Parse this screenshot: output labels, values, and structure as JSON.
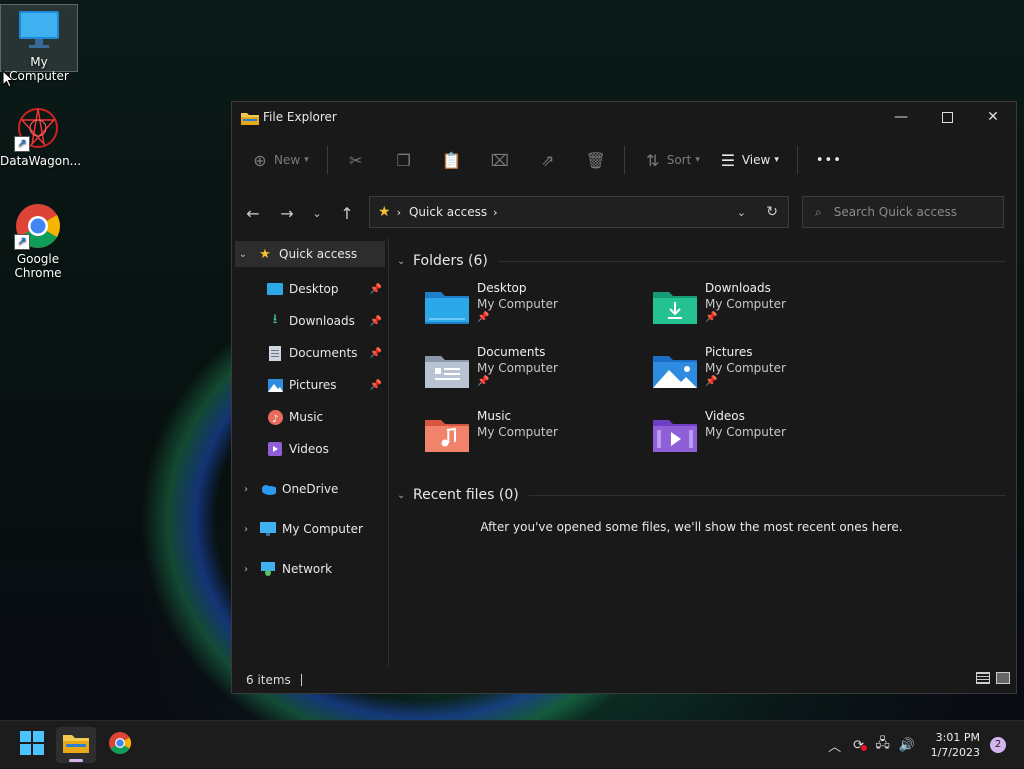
{
  "desktop": {
    "icons": [
      {
        "label": "My Computer"
      },
      {
        "label": "DataWagon..."
      },
      {
        "label": "Google Chrome"
      }
    ]
  },
  "window": {
    "title": "File Explorer",
    "toolbar": {
      "new_label": "New",
      "sort_label": "Sort",
      "view_label": "View",
      "more_label": "•••"
    },
    "address": {
      "location": "Quick access",
      "search_placeholder": "Search Quick access"
    },
    "nav": {
      "quick_access": "Quick access",
      "pinned": [
        {
          "label": "Desktop",
          "pinned": true
        },
        {
          "label": "Downloads",
          "pinned": true
        },
        {
          "label": "Documents",
          "pinned": true
        },
        {
          "label": "Pictures",
          "pinned": true
        },
        {
          "label": "Music",
          "pinned": false
        },
        {
          "label": "Videos",
          "pinned": false
        }
      ],
      "onedrive": "OneDrive",
      "mycomputer": "My Computer",
      "network": "Network"
    },
    "content": {
      "folders_heading": "Folders (6)",
      "folders": [
        {
          "name": "Desktop",
          "location": "My Computer",
          "pinned": true
        },
        {
          "name": "Downloads",
          "location": "My Computer",
          "pinned": true
        },
        {
          "name": "Documents",
          "location": "My Computer",
          "pinned": true
        },
        {
          "name": "Pictures",
          "location": "My Computer",
          "pinned": true
        },
        {
          "name": "Music",
          "location": "My Computer",
          "pinned": false
        },
        {
          "name": "Videos",
          "location": "My Computer",
          "pinned": false
        }
      ],
      "recent_heading": "Recent files (0)",
      "recent_empty": "After you've opened some files, we'll show the most recent ones here."
    },
    "status": {
      "items": "6 items"
    }
  },
  "taskbar": {
    "time": "3:01 PM",
    "date": "1/7/2023",
    "notifications": "2"
  },
  "colors": {
    "accent": "#0078d4",
    "window_bg": "#191919",
    "taskbar_bg": "#1c1c1c"
  }
}
